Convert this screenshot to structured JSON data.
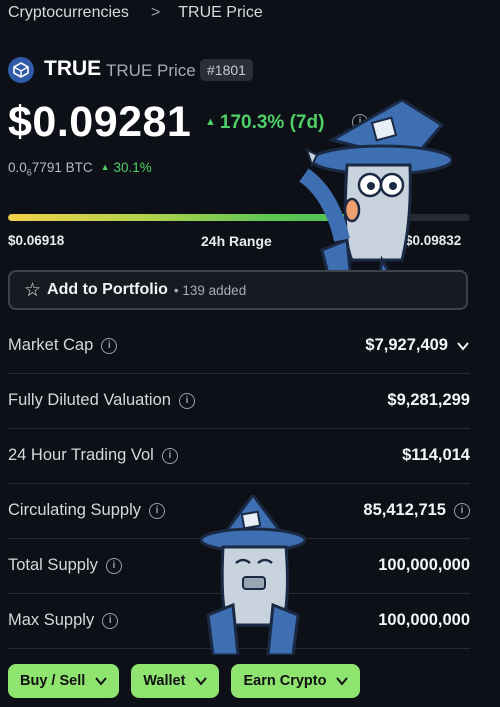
{
  "breadcrumb": {
    "root": "Cryptocurrencies",
    "separator": ">",
    "current": "TRUE Price"
  },
  "coin": {
    "symbol": "TRUE",
    "name": "TRUE Price",
    "rank": "#1801"
  },
  "price": {
    "value": "$0.09281",
    "change_7d": "170.3% (7d)",
    "btc_prefix": "0.0",
    "btc_subscript": "6",
    "btc_suffix": "7791 BTC",
    "btc_change": "30.1%"
  },
  "range": {
    "low": "$0.06918",
    "label": "24h Range",
    "high": "$0.09832",
    "position_fraction": 0.81
  },
  "portfolio": {
    "label": "Add to Portfolio",
    "added": "• 139 added"
  },
  "stats": [
    {
      "label": "Market Cap",
      "value": "$7,927,409"
    },
    {
      "label": "Fully Diluted Valuation",
      "value": "$9,281,299"
    },
    {
      "label": "24 Hour Trading Vol",
      "value": "$114,014"
    },
    {
      "label": "Circulating Supply",
      "value": "85,412,715"
    },
    {
      "label": "Total Supply",
      "value": "100,000,000"
    },
    {
      "label": "Max Supply",
      "value": "100,000,000"
    }
  ],
  "buttons": {
    "buy_sell": "Buy / Sell",
    "wallet": "Wallet",
    "earn": "Earn Crypto"
  },
  "colors": {
    "background": "#0d1117",
    "positive": "#4fcf67",
    "button_green": "#8fe36f",
    "accent_blue": "#2e5aa8"
  },
  "icons": [
    "star-icon",
    "info-icon",
    "chevron-down-icon",
    "coin-logo-icon",
    "wizard-mascot"
  ]
}
